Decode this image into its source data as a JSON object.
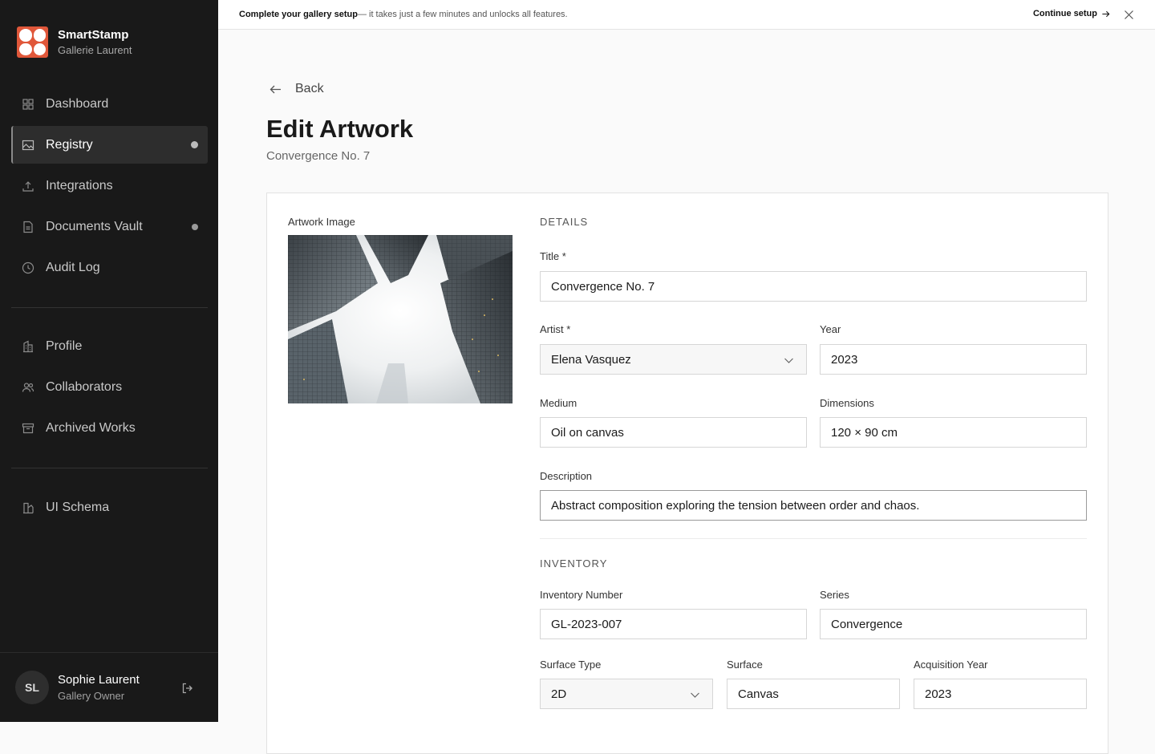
{
  "brand": {
    "name": "SmartStamp",
    "gallery": "Gallerie Laurent"
  },
  "nav": {
    "primary": [
      {
        "label": "Dashboard",
        "icon": "grid-icon"
      },
      {
        "label": "Registry",
        "icon": "image-icon",
        "active": true
      },
      {
        "label": "Integrations",
        "icon": "upload-icon"
      },
      {
        "label": "Documents Vault",
        "icon": "document-icon"
      },
      {
        "label": "Audit Log",
        "icon": "clock-icon"
      }
    ],
    "secondary": [
      {
        "label": "Profile",
        "icon": "building-icon"
      },
      {
        "label": "Collaborators",
        "icon": "users-icon"
      },
      {
        "label": "Archived Works",
        "icon": "archive-icon"
      }
    ],
    "tertiary": [
      {
        "label": "UI Schema",
        "icon": "schema-icon"
      }
    ]
  },
  "user": {
    "initials": "SL",
    "name": "Sophie Laurent",
    "role": "Gallery Owner"
  },
  "banner": {
    "strong": "Complete your gallery setup",
    "text": " — it takes just a few minutes and unlocks all features.",
    "cta": "Continue setup"
  },
  "page": {
    "back": "Back",
    "title": "Edit Artwork",
    "subtitle": "Convergence No. 7"
  },
  "image": {
    "label": "Artwork Image"
  },
  "details": {
    "heading": "DETAILS",
    "title": {
      "label": "Title *",
      "value": "Convergence No. 7"
    },
    "artist": {
      "label": "Artist *",
      "value": "Elena Vasquez"
    },
    "year": {
      "label": "Year",
      "value": "2023"
    },
    "medium": {
      "label": "Medium",
      "value": "Oil on canvas"
    },
    "dimensions": {
      "label": "Dimensions",
      "value": "120 × 90 cm"
    },
    "description": {
      "label": "Description",
      "value": "Abstract composition exploring the tension between order and chaos."
    }
  },
  "inventory": {
    "heading": "INVENTORY",
    "number": {
      "label": "Inventory Number",
      "value": "GL-2023-007"
    },
    "series": {
      "label": "Series",
      "value": "Convergence"
    },
    "surface_type": {
      "label": "Surface Type",
      "value": "2D"
    },
    "surface": {
      "label": "Surface",
      "value": "Canvas"
    },
    "acquisition_year": {
      "label": "Acquisition Year",
      "value": "2023"
    }
  },
  "colors": {
    "brand": "#e0573a",
    "sidebar": "#191919",
    "background": "#fafafa"
  }
}
